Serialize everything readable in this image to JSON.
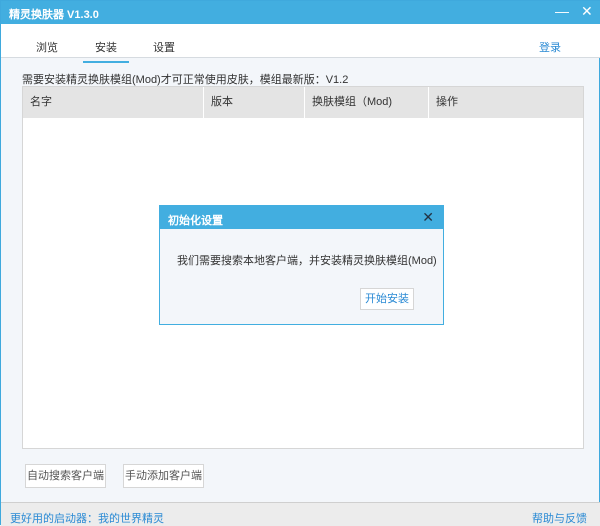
{
  "window": {
    "title": "精灵换肤器 V1.3.0",
    "minimize": "—",
    "close": "✕"
  },
  "tabs": [
    {
      "label": "浏览"
    },
    {
      "label": "安装"
    },
    {
      "label": "设置"
    }
  ],
  "login": "登录",
  "notice": "需要安装精灵换肤模组(Mod)才可正常使用皮肤，模组最新版：V1.2",
  "table": {
    "columns": [
      "名字",
      "版本",
      "换肤模组（Mod)",
      "操作"
    ]
  },
  "buttons": {
    "auto_search": "自动搜索客户端",
    "manual_add": "手动添加客户端"
  },
  "footer": {
    "left": "更好用的启动器：我的世界精灵",
    "right": "帮助与反馈"
  },
  "dialog": {
    "title": "初始化设置",
    "close": "✕",
    "message": "我们需要搜索本地客户端，并安装精灵换肤模组(Mod)",
    "start": "开始安装"
  }
}
